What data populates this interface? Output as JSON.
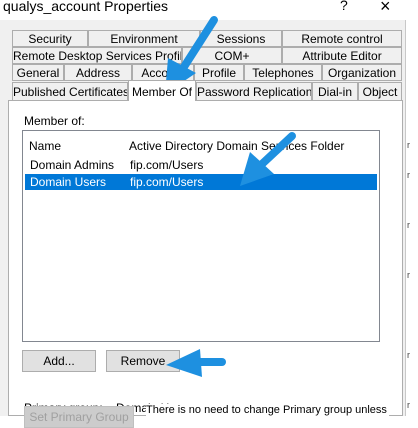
{
  "window": {
    "title": "qualys_account Properties",
    "help_glyph": "?",
    "close_glyph": "×"
  },
  "tabs": {
    "row1": [
      "Security",
      "Environment",
      "Sessions",
      "Remote control"
    ],
    "row2": [
      "Remote Desktop Services Profile",
      "COM+",
      "Attribute Editor"
    ],
    "row3": [
      "General",
      "Address",
      "Account",
      "Profile",
      "Telephones",
      "Organization"
    ],
    "row4": [
      "Published Certificates",
      "Member Of",
      "Password Replication",
      "Dial-in",
      "Object"
    ],
    "active": "Member Of"
  },
  "member_of": {
    "label": "Member of:",
    "columns": [
      "Name",
      "Active Directory Domain Services Folder"
    ],
    "rows": [
      {
        "name": "Domain Admins",
        "folder": "fip.com/Users",
        "selected": false
      },
      {
        "name": "Domain Users",
        "folder": "fip.com/Users",
        "selected": true
      }
    ]
  },
  "buttons": {
    "add": "Add...",
    "remove": "Remove",
    "set_primary": "Set Primary Group"
  },
  "primary_group": {
    "label": "Primary group:",
    "value": "Domain Users",
    "note": "There is no need to change Primary group unless"
  },
  "colors": {
    "selection": "#0078d7",
    "annotation_arrow": "#1e90e0"
  },
  "annotations": [
    "arrow-pointing-member-of-tab",
    "arrow-pointing-domain-users-row",
    "arrow-pointing-remove-button"
  ]
}
